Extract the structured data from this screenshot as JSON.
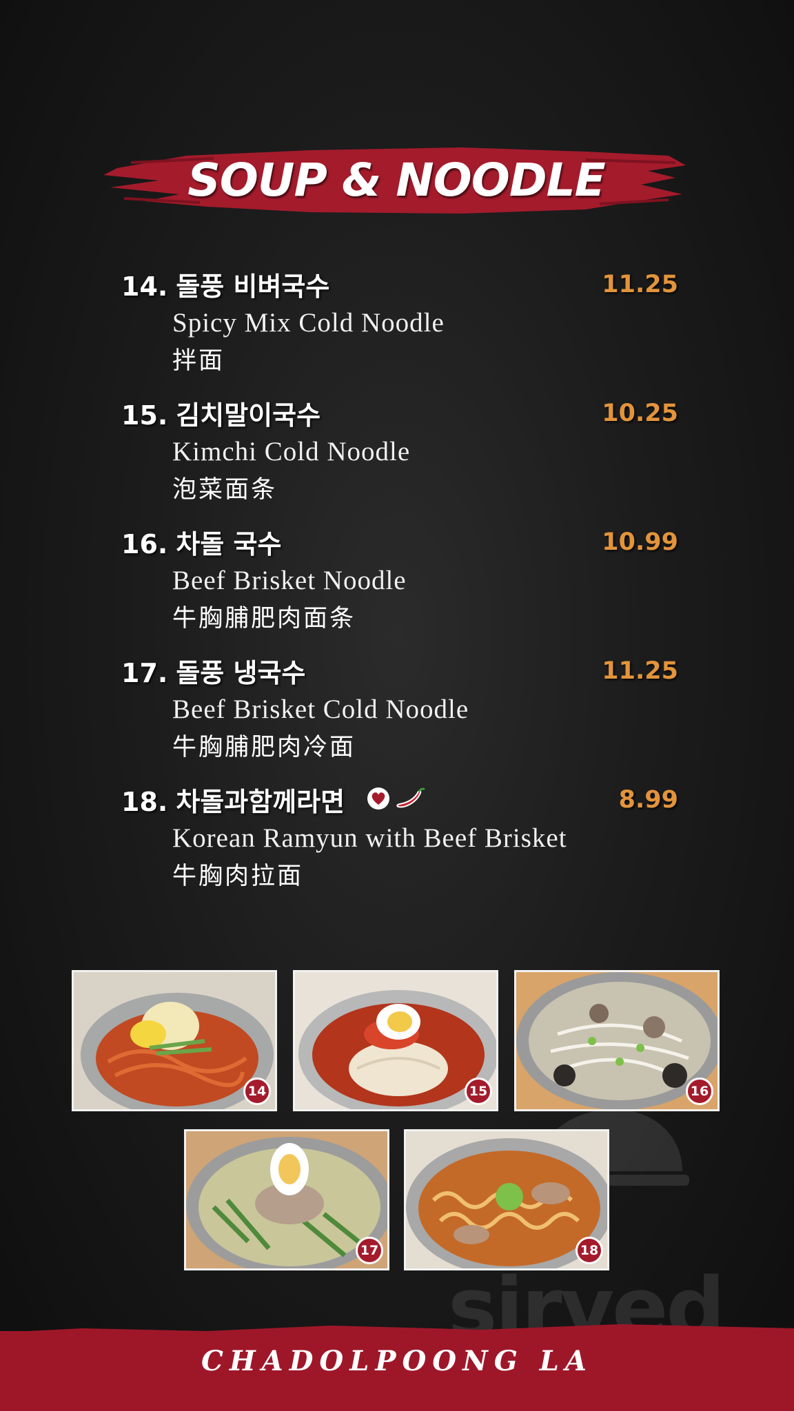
{
  "header": {
    "title": "SOUP & NOODLE"
  },
  "items": [
    {
      "num": "14.",
      "ko": "돌풍 비벼국수",
      "en": "Spicy Mix Cold Noodle",
      "zh": "拌面",
      "price": "11.25"
    },
    {
      "num": "15.",
      "ko": "김치말이국수",
      "en": "Kimchi Cold Noodle",
      "zh": "泡菜面条",
      "price": "10.25"
    },
    {
      "num": "16.",
      "ko": "차돌 국수",
      "en": "Beef Brisket Noodle",
      "zh": "牛胸脯肥肉面条",
      "price": "10.99"
    },
    {
      "num": "17.",
      "ko": "돌풍 냉국수",
      "en": "Beef Brisket Cold Noodle",
      "zh": "牛胸脯肥肉冷面",
      "price": "11.25"
    },
    {
      "num": "18.",
      "ko": "차돌과함께라면",
      "en": "Korean Ramyun with Beef Brisket",
      "zh": "牛胸肉拉面",
      "price": "8.99",
      "icons": [
        "heart-icon",
        "chili-pepper-icon"
      ]
    }
  ],
  "photos": [
    {
      "badge": "14"
    },
    {
      "badge": "15"
    },
    {
      "badge": "16"
    },
    {
      "badge": "17"
    },
    {
      "badge": "18"
    }
  ],
  "footer": {
    "text": "CHADOLPOONG LA"
  },
  "watermark": {
    "text": "sirved"
  },
  "colors": {
    "accent_red": "#9e1729",
    "price_orange": "#e3943b",
    "background": "#1c1c1c"
  }
}
